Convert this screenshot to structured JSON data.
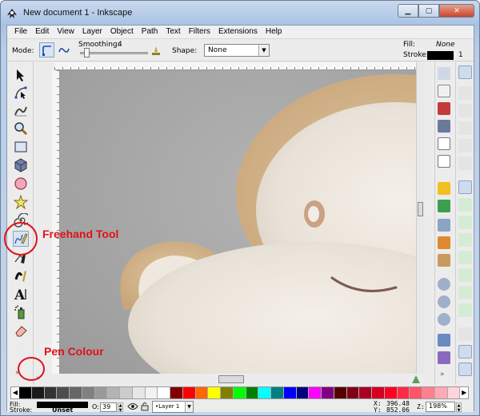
{
  "window": {
    "title": "New document 1 - Inkscape"
  },
  "menu": [
    "File",
    "Edit",
    "View",
    "Layer",
    "Object",
    "Path",
    "Text",
    "Filters",
    "Extensions",
    "Help"
  ],
  "controls": {
    "mode_label": "Mode:",
    "smoothing_label": "Smoothing:",
    "smoothing_value": "4",
    "shape_label": "Shape:",
    "shape_value": "None"
  },
  "style_indicator": {
    "fill_label": "Fill:",
    "fill_value": "None",
    "stroke_label": "Stroke:",
    "stroke_width": "1",
    "stroke_color": "#000000"
  },
  "tools": [
    "selector-tool-icon",
    "node-tool-icon",
    "tweak-tool-icon",
    "zoom-tool-icon",
    "rectangle-tool-icon",
    "box-3d-tool-icon",
    "ellipse-tool-icon",
    "star-tool-icon",
    "spiral-tool-icon",
    "freehand-tool-icon",
    "pen-tool-icon",
    "calligraphy-tool-icon",
    "text-tool-icon",
    "spray-tool-icon",
    "eraser-tool-icon"
  ],
  "active_tool": "freehand-tool-icon",
  "annotations": {
    "freehand": "Freehand Tool",
    "pen_colour": "Pen Colour"
  },
  "palette": [
    "#000000",
    "#1a1a1a",
    "#333333",
    "#4d4d4d",
    "#666666",
    "#808080",
    "#999999",
    "#b3b3b3",
    "#cccccc",
    "#e6e6e6",
    "#f2f2f2",
    "#ffffff",
    "#800000",
    "#ff0000",
    "#ff6600",
    "#ffff00",
    "#808000",
    "#00ff00",
    "#008000",
    "#00ffff",
    "#008080",
    "#0000ff",
    "#000080",
    "#ff00ff",
    "#800080",
    "#550000",
    "#800015",
    "#aa0022",
    "#d40020",
    "#ff0022",
    "#ff2a45",
    "#ff5566",
    "#ff8090",
    "#ffaab5",
    "#ffd5db"
  ],
  "status": {
    "fill_label": "Fill:",
    "stroke_label": "Stroke:",
    "stroke_value": "Unset",
    "opacity_label": "O:",
    "opacity_value": "39",
    "layer_value": "•Layer 1",
    "x_label": "X:",
    "x_value": "396.48",
    "y_label": "Y:",
    "y_value": "852.06",
    "zoom_label": "Z:",
    "zoom_value": "198%"
  }
}
